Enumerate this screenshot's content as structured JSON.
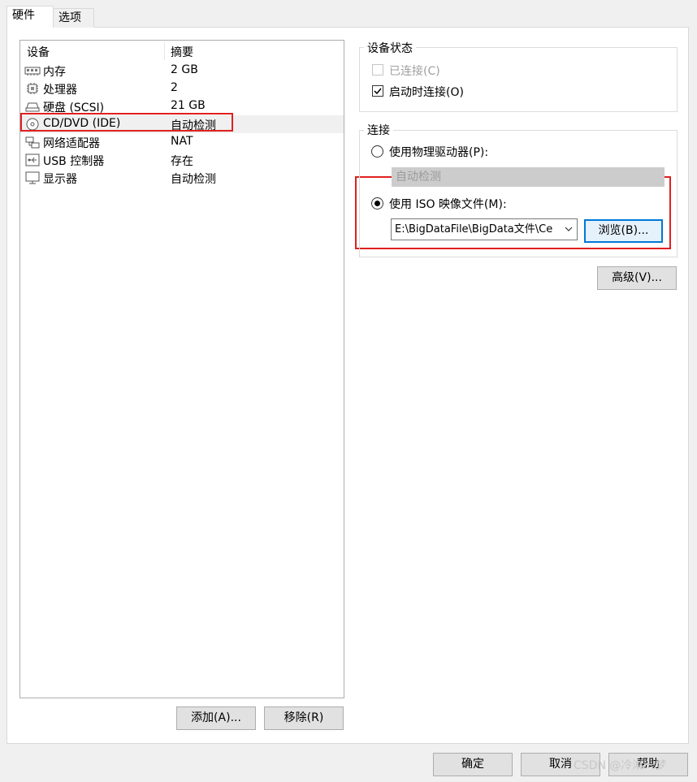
{
  "tabs": [
    {
      "label": "硬件",
      "active": true
    },
    {
      "label": "选项",
      "active": false
    }
  ],
  "device_list": {
    "col_device": "设备",
    "col_summary": "摘要",
    "rows": [
      {
        "name": "内存",
        "summary": "2 GB",
        "icon": "memory-icon"
      },
      {
        "name": "处理器",
        "summary": "2",
        "icon": "processor-icon"
      },
      {
        "name": "硬盘 (SCSI)",
        "summary": "21 GB",
        "icon": "hard-disk-icon"
      },
      {
        "name": "CD/DVD (IDE)",
        "summary": "自动检测",
        "icon": "cd-dvd-icon",
        "selected": true
      },
      {
        "name": "网络适配器",
        "summary": "NAT",
        "icon": "network-adapter-icon"
      },
      {
        "name": "USB 控制器",
        "summary": "存在",
        "icon": "usb-controller-icon"
      },
      {
        "name": "显示器",
        "summary": "自动检测",
        "icon": "display-icon"
      }
    ]
  },
  "buttons": {
    "add": "添加(A)...",
    "remove": "移除(R)",
    "browse": "浏览(B)...",
    "advanced": "高级(V)...",
    "ok": "确定",
    "cancel": "取消",
    "help": "帮助"
  },
  "device_status": {
    "title": "设备状态",
    "connected": {
      "label": "已连接(C)",
      "checked": false,
      "disabled": true
    },
    "connect_at_power_on": {
      "label": "启动时连接(O)",
      "checked": true
    }
  },
  "connection": {
    "title": "连接",
    "physical_drive": {
      "label": "使用物理驱动器(P):",
      "selected": false,
      "drive_value": "自动检测"
    },
    "iso_image": {
      "label": "使用 ISO 映像文件(M):",
      "selected": true,
      "path_value": "E:\\BigDataFile\\BigData文件\\Ce"
    }
  },
  "watermark": "CSDN @冷淋一梦",
  "colors": {
    "highlight": "#e02020",
    "focus": "#0078d7"
  }
}
